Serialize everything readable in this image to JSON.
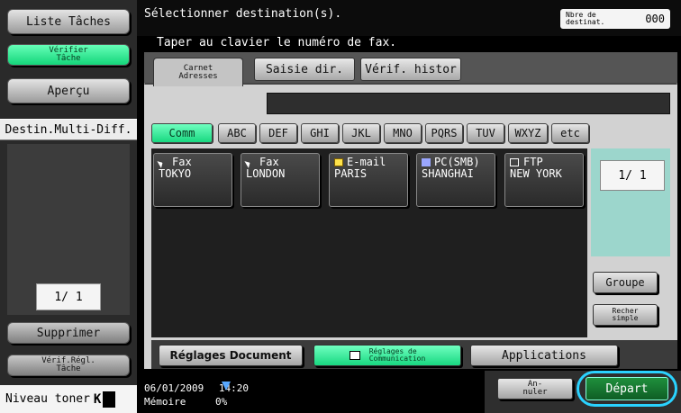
{
  "left": {
    "liste_taches": "Liste Tâches",
    "verifier_tache": "Vérifier\nTâche",
    "apercu": "Aperçu",
    "destin_multi": "Destin.Multi-Diff.",
    "page_indicator": "1/ 1",
    "supprimer": "Supprimer",
    "verif_regl": "Vérif.Régl.\nTâche",
    "toner_label": "Niveau toner",
    "toner_letter": "K"
  },
  "header": {
    "title": "Sélectionner destination(s).",
    "subtitle": "Taper au clavier le numéro de fax.",
    "dest_count_label": "Nbre de\ndestinat.",
    "dest_count_value": "000"
  },
  "tabs": [
    {
      "label": "Carnet\nAdresses"
    },
    {
      "label": "Saisie dir."
    },
    {
      "label": "Vérif. histor"
    }
  ],
  "filters": [
    "Comm",
    "ABC",
    "DEF",
    "GHI",
    "JKL",
    "MNO",
    "PQRS",
    "TUV",
    "WXYZ",
    "etc"
  ],
  "entries": [
    {
      "type": "Fax",
      "name": "TOKYO",
      "icon": "fax-icon"
    },
    {
      "type": "Fax",
      "name": "LONDON",
      "icon": "fax-icon"
    },
    {
      "type": "E-mail",
      "name": "PARIS",
      "icon": "email-icon"
    },
    {
      "type": "PC(SMB)",
      "name": "SHANGHAI",
      "icon": "pc-icon"
    },
    {
      "type": "FTP",
      "name": "NEW YORK",
      "icon": "ftp-icon"
    }
  ],
  "list_page": "1/ 1",
  "side_buttons": {
    "groupe": "Groupe",
    "rech_simple": "Recher\nsimple"
  },
  "bottom": {
    "reglages_document": "Réglages Document",
    "reglages_comm": "Réglages de\nCommunication",
    "applications": "Applications"
  },
  "footer": {
    "date": "06/01/2009",
    "time": "14:20",
    "memoire_label": "Mémoire",
    "memoire_value": "0%",
    "annuler": "An-\nnuler",
    "depart": "Départ"
  },
  "colors": {
    "accent_green": "#18d880",
    "highlight_ring": "#2ad2ff",
    "depart_green": "#1f8f3c"
  }
}
